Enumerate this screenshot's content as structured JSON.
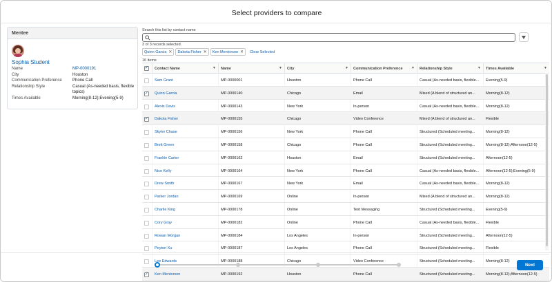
{
  "modal": {
    "title": "Select providers to compare"
  },
  "mentee": {
    "header": "Mentee",
    "name": "Sophia Student",
    "fields": [
      {
        "label": "Name",
        "value": "MP-0000191",
        "link": true
      },
      {
        "label": "City",
        "value": "Houston",
        "link": false
      },
      {
        "label": "Communication Preference",
        "value": "Phone Call",
        "link": false
      },
      {
        "label": "Relationship Style",
        "value": "Casual (As-needed basis, flexible topics)",
        "link": false
      },
      {
        "label": "Times Available",
        "value": "Morning(8-12);Evening(5-9)",
        "link": false
      }
    ]
  },
  "search": {
    "label": "Search this list by contact name",
    "value": "",
    "placeholder": ""
  },
  "selection": {
    "count_text": "3 of 3 records selected.",
    "pills": [
      "Quinn Garcia",
      "Dakota Fisher",
      "Ken Mentorson"
    ],
    "clear_label": "Clear Selected"
  },
  "items_count": "16 items",
  "table": {
    "columns": [
      "Contact Name",
      "Name",
      "City",
      "Communication Preference",
      "Relationship Style",
      "Times Available"
    ],
    "rows": [
      {
        "selected": false,
        "contact": "Sam Grant",
        "name": "MP-0000001",
        "city": "Houston",
        "comm": "Phone Call",
        "style": "Casual (As-needed basis, flexible...",
        "times": "Evening(5-9)"
      },
      {
        "selected": true,
        "contact": "Quinn Garcia",
        "name": "MP-0000140",
        "city": "Chicago",
        "comm": "Email",
        "style": "Mixed (A blend of structured an...",
        "times": "Morning(8-12)"
      },
      {
        "selected": false,
        "contact": "Alexis Davis",
        "name": "MP-0000143",
        "city": "New York",
        "comm": "In-person",
        "style": "Casual (As-needed basis, flexible...",
        "times": "Morning(8-12)"
      },
      {
        "selected": true,
        "contact": "Dakota Fisher",
        "name": "MP-0000155",
        "city": "Chicago",
        "comm": "Video Conference",
        "style": "Mixed (A blend of structured an...",
        "times": "Flexible"
      },
      {
        "selected": false,
        "contact": "Skyler Chase",
        "name": "MP-0000156",
        "city": "New York",
        "comm": "Phone Call",
        "style": "Structured (Scheduled meeting...",
        "times": "Morning(8-12)"
      },
      {
        "selected": false,
        "contact": "Brett Green",
        "name": "MP-0000158",
        "city": "Chicago",
        "comm": "Phone Call",
        "style": "Structured (Scheduled meeting...",
        "times": "Morning(8-12);Afternoon(12-5)"
      },
      {
        "selected": false,
        "contact": "Frankie Carter",
        "name": "MP-0000162",
        "city": "Houston",
        "comm": "Email",
        "style": "Structured (Scheduled meeting...",
        "times": "Afternoon(12-5)"
      },
      {
        "selected": false,
        "contact": "Nico Kelly",
        "name": "MP-0000164",
        "city": "New York",
        "comm": "Phone Call",
        "style": "Casual (As-needed basis, flexible...",
        "times": "Afternoon(12-5);Evening(5-9)"
      },
      {
        "selected": false,
        "contact": "Drew Smith",
        "name": "MP-0000167",
        "city": "New York",
        "comm": "Email",
        "style": "Casual (As-needed basis, flexible...",
        "times": "Morning(8-12)"
      },
      {
        "selected": false,
        "contact": "Parker Jordan",
        "name": "MP-0000169",
        "city": "Online",
        "comm": "In-person",
        "style": "Mixed (A blend of structured an...",
        "times": "Morning(8-12)"
      },
      {
        "selected": false,
        "contact": "Charlie King",
        "name": "MP-0000178",
        "city": "Online",
        "comm": "Text Messaging",
        "style": "Structured (Scheduled meeting...",
        "times": "Evening(5-9)"
      },
      {
        "selected": false,
        "contact": "Cory Gray",
        "name": "MP-0000182",
        "city": "Online",
        "comm": "Phone Call",
        "style": "Casual (As-needed basis, flexible...",
        "times": "Flexible"
      },
      {
        "selected": false,
        "contact": "Rowan Morgan",
        "name": "MP-0000184",
        "city": "Los Angeles",
        "comm": "In-person",
        "style": "Structured (Scheduled meeting...",
        "times": "Afternoon(12-5)"
      },
      {
        "selected": false,
        "contact": "Peyton Xu",
        "name": "MP-0000187",
        "city": "Los Angeles",
        "comm": "Phone Call",
        "style": "Structured (Scheduled meeting...",
        "times": "Flexible"
      },
      {
        "selected": false,
        "contact": "Lee Edwards",
        "name": "MP-0000188",
        "city": "Chicago",
        "comm": "Video Conference",
        "style": "Structured (Scheduled meeting...",
        "times": "Morning(8-12)"
      },
      {
        "selected": true,
        "contact": "Ken Mentorson",
        "name": "MP-0000192",
        "city": "Houston",
        "comm": "Phone Call",
        "style": "Structured (Scheduled meeting...",
        "times": "Morning(8-12);Afternoon(12-5)"
      }
    ]
  },
  "progress": {
    "current_step": 1,
    "total_steps": 4
  },
  "footer": {
    "next_label": "Next"
  },
  "colors": {
    "brand": "#0176d3",
    "link": "#0b5cab"
  }
}
